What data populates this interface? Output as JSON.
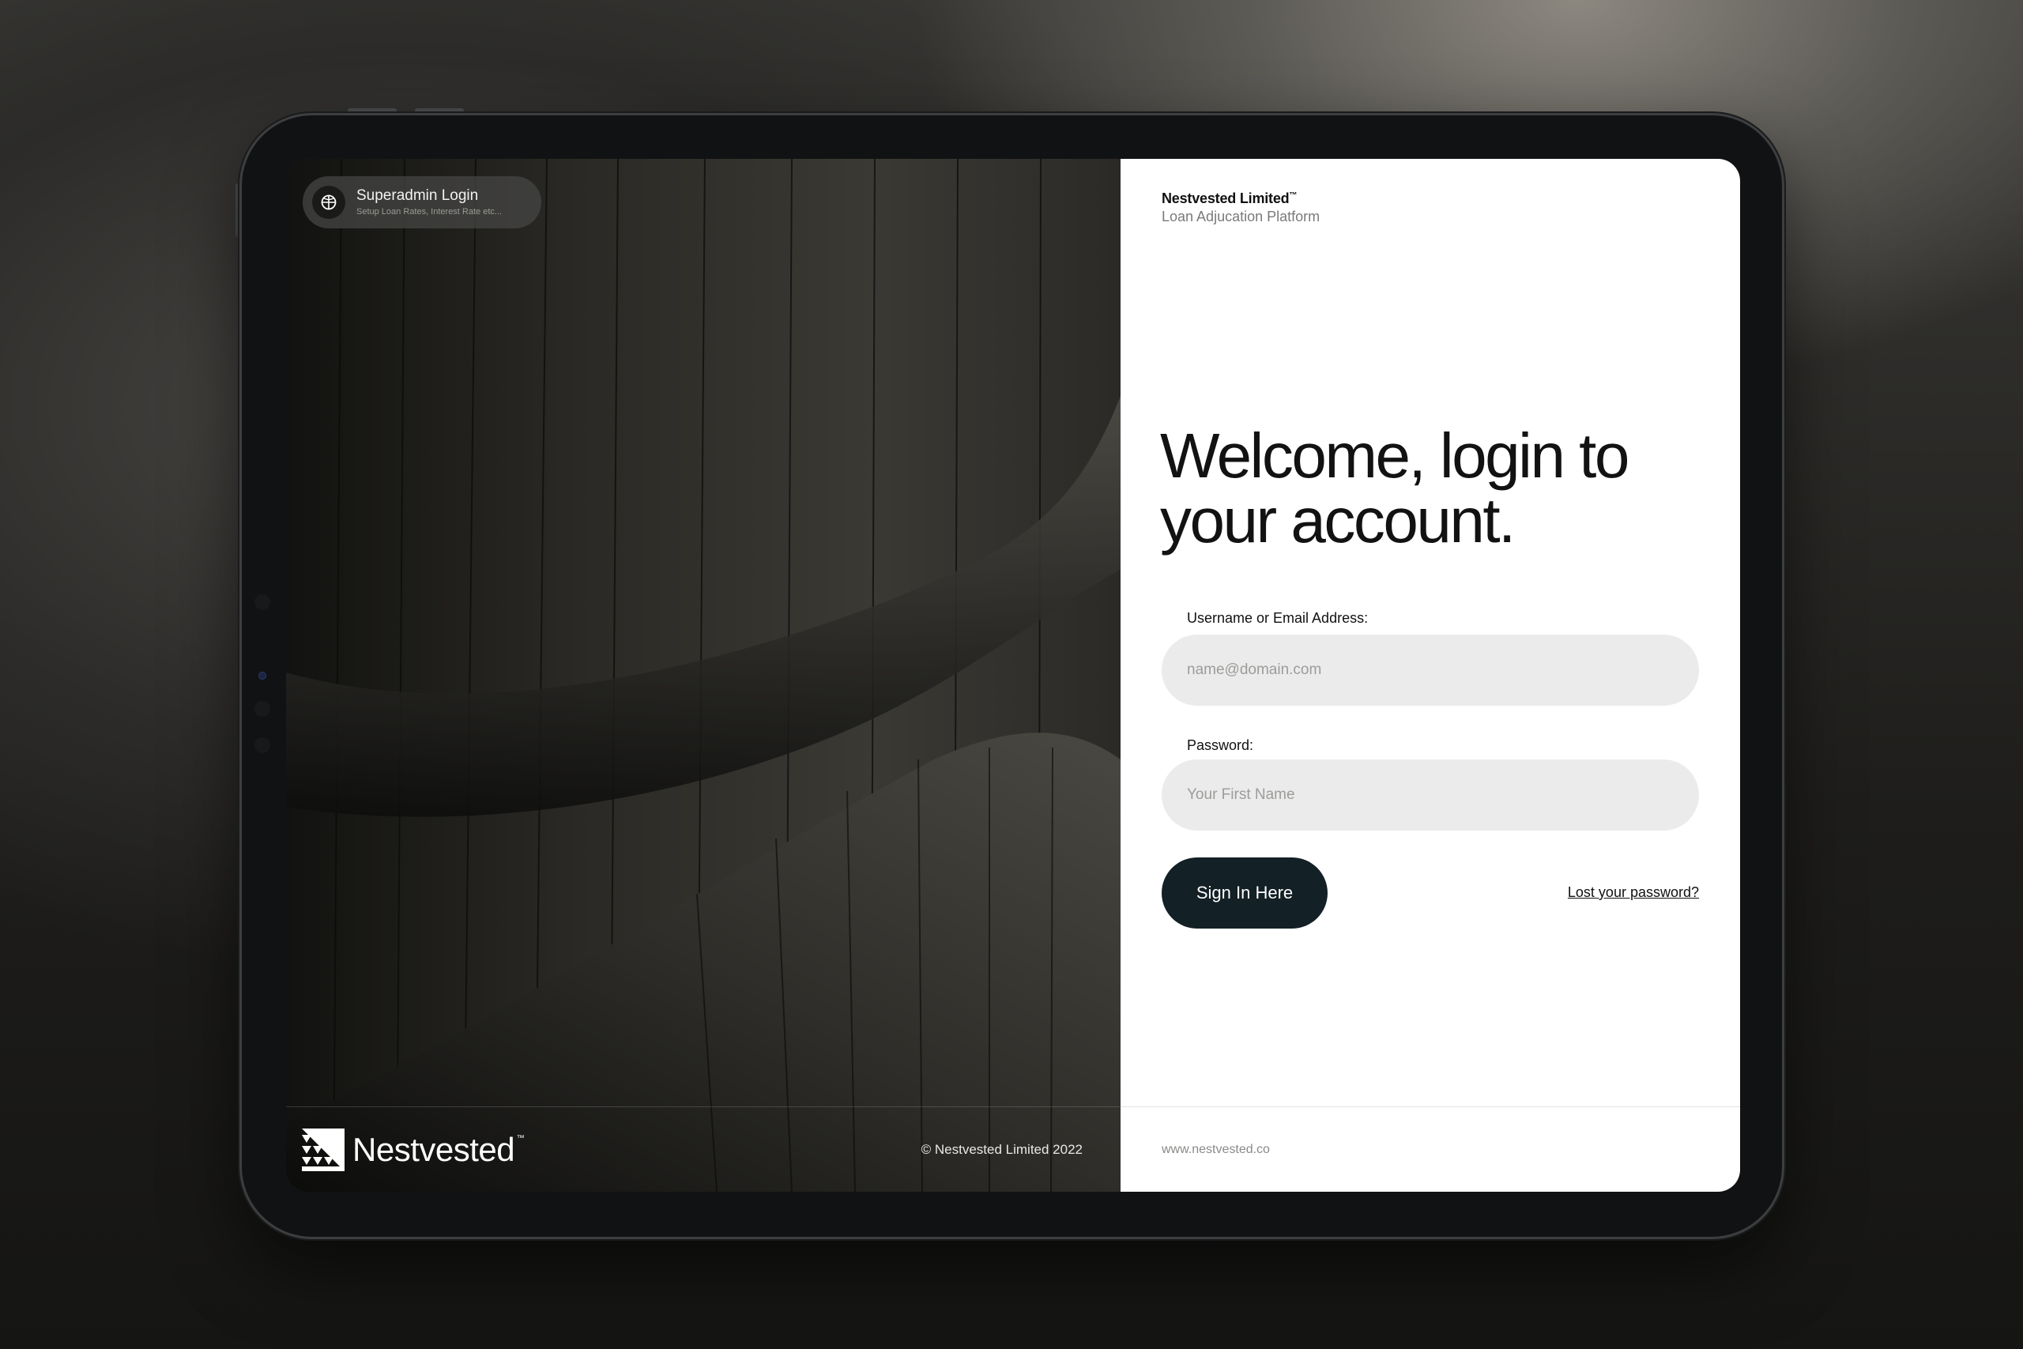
{
  "admin_pill": {
    "title": "Superadmin Login",
    "subtitle": "Setup Loan Rates, Interest Rate etc...",
    "icon": "globe-icon"
  },
  "brand": {
    "name": "Nestvested",
    "trademark": "™",
    "logo": "nestvested-logo"
  },
  "copyright": "© Nestvested Limited 2022",
  "company": {
    "name": "Nestvested Limited",
    "trademark": "™",
    "tagline": "Loan Adjucation Platform"
  },
  "welcome": "Welcome, login to your account.",
  "form": {
    "username_label": "Username or Email Address:",
    "username_placeholder": "name@domain.com",
    "password_label": "Password:",
    "password_placeholder": "Your First Name",
    "signin_label": "Sign In Here",
    "lost_password": "Lost your password?"
  },
  "website": "www.nestvested.co",
  "colors": {
    "button_bg": "#132026",
    "input_bg": "#ebebeb",
    "panel_bg": "#ffffff"
  }
}
